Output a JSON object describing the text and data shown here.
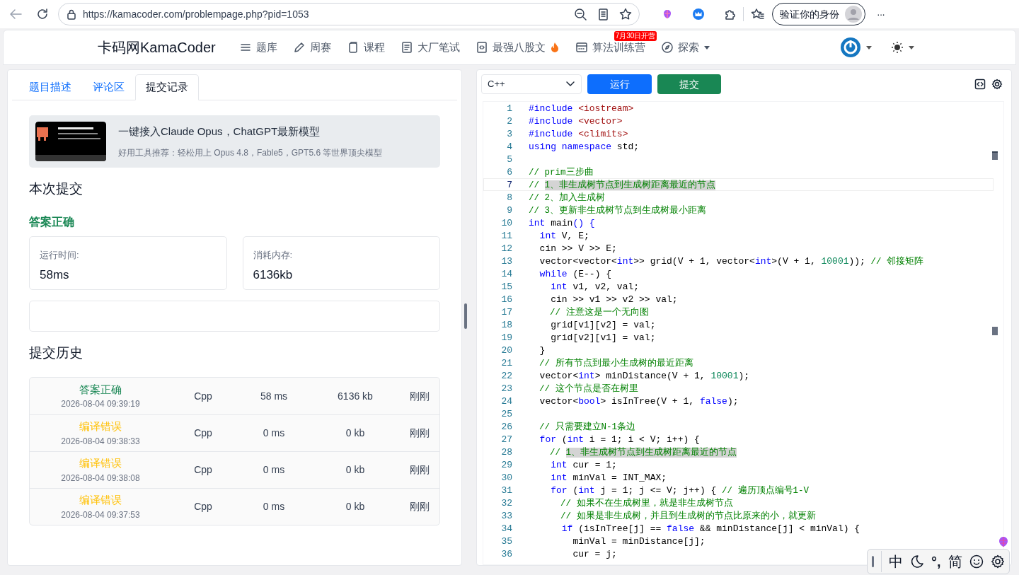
{
  "browser": {
    "url": "https://kamacoder.com/problempage.php?pid=1053",
    "profile_button": "验证你的身份",
    "more": "···"
  },
  "navbar": {
    "brand": "卡码网KamaCoder",
    "items": [
      {
        "label": "题库",
        "kind": "list"
      },
      {
        "label": "周赛",
        "kind": "pencil"
      },
      {
        "label": "课程",
        "kind": "pages"
      },
      {
        "label": "大厂笔试",
        "kind": "doc"
      },
      {
        "label": "最强八股文",
        "kind": "code",
        "flame": true
      },
      {
        "label": "算法训练营",
        "kind": "calendar",
        "badge": "7月30日开营"
      },
      {
        "label": "探索",
        "kind": "compass",
        "dropdown": true
      }
    ]
  },
  "left_panel": {
    "tabs": [
      {
        "label": "题目描述",
        "selected": false
      },
      {
        "label": "评论区",
        "selected": false
      },
      {
        "label": "提交记录",
        "selected": true
      }
    ],
    "banner": {
      "title": "一键接入Claude Opus，ChatGPT最新模型",
      "subtitle": "好用工具推荐：轻松用上 Opus 4.8，Fable5，GPT5.6 等世界顶尖模型"
    },
    "current_heading": "本次提交",
    "result": "答案正确",
    "stats": [
      {
        "label": "运行时间:",
        "value": "58ms"
      },
      {
        "label": "消耗内存:",
        "value": "6136kb"
      }
    ],
    "history_heading": "提交历史",
    "history": [
      {
        "status": "答案正确",
        "kind": "accepted",
        "time": "2026-08-04 09:39:19",
        "language": "Cpp",
        "runtime": "58 ms",
        "memory": "6136 kb",
        "ago": "刚刚"
      },
      {
        "status": "编译错误",
        "kind": "compile_error",
        "time": "2026-08-04 09:38:33",
        "language": "Cpp",
        "runtime": "0 ms",
        "memory": "0 kb",
        "ago": "刚刚"
      },
      {
        "status": "编译错误",
        "kind": "compile_error",
        "time": "2026-08-04 09:38:08",
        "language": "Cpp",
        "runtime": "0 ms",
        "memory": "0 kb",
        "ago": "刚刚"
      },
      {
        "status": "编译错误",
        "kind": "compile_error",
        "time": "2026-08-04 09:37:53",
        "language": "Cpp",
        "runtime": "0 ms",
        "memory": "0 kb",
        "ago": "刚刚"
      }
    ]
  },
  "editor": {
    "language": "C++",
    "run_button": "运行",
    "submit_button": "提交",
    "lines": [
      {
        "number": "1",
        "current": false,
        "tokens": [
          {
            "kind": "keyword",
            "text": "#include "
          },
          {
            "kind": "string",
            "text": "<iostream>"
          }
        ]
      },
      {
        "number": "2",
        "current": false,
        "tokens": [
          {
            "kind": "keyword",
            "text": "#include "
          },
          {
            "kind": "string",
            "text": "<vector>"
          }
        ]
      },
      {
        "number": "3",
        "current": false,
        "tokens": [
          {
            "kind": "keyword",
            "text": "#include "
          },
          {
            "kind": "string",
            "text": "<climits>"
          }
        ]
      },
      {
        "number": "4",
        "current": false,
        "tokens": [
          {
            "kind": "keyword",
            "text": "using namespace "
          },
          {
            "kind": "plain",
            "text": "std;"
          }
        ]
      },
      {
        "number": "5",
        "current": false
      },
      {
        "number": "6",
        "current": false,
        "tokens": [
          {
            "kind": "comment",
            "text": "// prim三步曲"
          }
        ]
      },
      {
        "number": "7",
        "current": true,
        "tokens": [
          {
            "kind": "comment",
            "text": "// "
          },
          {
            "kind": "selected_comment",
            "text": "1、非生成树节点到生成树距离最近的节点"
          }
        ]
      },
      {
        "number": "8",
        "current": false,
        "tokens": [
          {
            "kind": "comment",
            "text": "// 2、加入生成树"
          }
        ]
      },
      {
        "number": "9",
        "current": false,
        "tokens": [
          {
            "kind": "comment",
            "text": "// 3、更新非生成树节点到生成树最小距离"
          }
        ]
      },
      {
        "number": "10",
        "current": false,
        "tokens": [
          {
            "kind": "keyword",
            "text": "int "
          },
          {
            "kind": "plain",
            "text": "main"
          },
          {
            "kind": "keyword",
            "text": "() {"
          }
        ]
      },
      {
        "number": "11",
        "current": false,
        "tokens": [
          {
            "kind": "keyword",
            "text": "  int "
          },
          {
            "kind": "plain",
            "text": "V, E;"
          }
        ]
      },
      {
        "number": "12",
        "current": false,
        "tokens": [
          {
            "kind": "plain",
            "text": "  cin >> V >> E;"
          }
        ]
      },
      {
        "number": "13",
        "current": false,
        "tokens": [
          {
            "kind": "plain",
            "text": "  vector<vector<"
          },
          {
            "kind": "keyword",
            "text": "int"
          },
          {
            "kind": "plain",
            "text": ">> grid(V + 1, vector<"
          },
          {
            "kind": "keyword",
            "text": "int"
          },
          {
            "kind": "plain",
            "text": ">(V + 1, "
          },
          {
            "kind": "number",
            "text": "10001"
          },
          {
            "kind": "plain",
            "text": "));"
          },
          {
            "kind": "comment",
            "text": " // 邻接矩阵"
          }
        ]
      },
      {
        "number": "14",
        "current": false,
        "tokens": [
          {
            "kind": "keyword",
            "text": "  while "
          },
          {
            "kind": "plain",
            "text": "(E--) {"
          }
        ]
      },
      {
        "number": "15",
        "current": false,
        "tokens": [
          {
            "kind": "keyword",
            "text": "    int "
          },
          {
            "kind": "plain",
            "text": "v1, v2, val;"
          }
        ]
      },
      {
        "number": "16",
        "current": false,
        "tokens": [
          {
            "kind": "plain",
            "text": "    cin >> v1 >> v2 >> val;"
          }
        ]
      },
      {
        "number": "17",
        "current": false,
        "tokens": [
          {
            "kind": "comment",
            "text": "    // 注意这是一个无向图"
          }
        ]
      },
      {
        "number": "18",
        "current": false,
        "tokens": [
          {
            "kind": "plain",
            "text": "    grid[v1][v2] = val;"
          }
        ]
      },
      {
        "number": "19",
        "current": false,
        "tokens": [
          {
            "kind": "plain",
            "text": "    grid[v2][v1] = val;"
          }
        ]
      },
      {
        "number": "20",
        "current": false,
        "tokens": [
          {
            "kind": "plain",
            "text": "  }"
          }
        ]
      },
      {
        "number": "21",
        "current": false,
        "tokens": [
          {
            "kind": "comment",
            "text": "  // 所有节点到最小生成树的最近距离"
          }
        ]
      },
      {
        "number": "22",
        "current": false,
        "tokens": [
          {
            "kind": "plain",
            "text": "  vector<"
          },
          {
            "kind": "keyword",
            "text": "int"
          },
          {
            "kind": "plain",
            "text": "> minDistance(V + 1, "
          },
          {
            "kind": "number",
            "text": "10001"
          },
          {
            "kind": "plain",
            "text": ");"
          }
        ]
      },
      {
        "number": "23",
        "current": false,
        "tokens": [
          {
            "kind": "comment",
            "text": "  // 这个节点是否在树里"
          }
        ]
      },
      {
        "number": "24",
        "current": false,
        "tokens": [
          {
            "kind": "plain",
            "text": "  vector<"
          },
          {
            "kind": "keyword",
            "text": "bool"
          },
          {
            "kind": "plain",
            "text": "> isInTree(V + 1, "
          },
          {
            "kind": "keyword",
            "text": "false"
          },
          {
            "kind": "plain",
            "text": ");"
          }
        ]
      },
      {
        "number": "25",
        "current": false
      },
      {
        "number": "26",
        "current": false,
        "tokens": [
          {
            "kind": "comment",
            "text": "  // 只需要建立N-1条边"
          }
        ]
      },
      {
        "number": "27",
        "current": false,
        "tokens": [
          {
            "kind": "keyword",
            "text": "  for "
          },
          {
            "kind": "plain",
            "text": "("
          },
          {
            "kind": "keyword",
            "text": "int "
          },
          {
            "kind": "plain",
            "text": "i = 1; i < V; i++) {"
          }
        ]
      },
      {
        "number": "28",
        "current": false,
        "tokens": [
          {
            "kind": "comment",
            "text": "    // "
          },
          {
            "kind": "selected_comment",
            "text": "1、非生成树节点到生成树距离最近的节点"
          }
        ]
      },
      {
        "number": "29",
        "current": false,
        "tokens": [
          {
            "kind": "keyword",
            "text": "    int "
          },
          {
            "kind": "plain",
            "text": "cur = 1;"
          }
        ]
      },
      {
        "number": "30",
        "current": false,
        "tokens": [
          {
            "kind": "keyword",
            "text": "    int "
          },
          {
            "kind": "plain",
            "text": "minVal = INT_MAX;"
          }
        ]
      },
      {
        "number": "31",
        "current": false,
        "tokens": [
          {
            "kind": "keyword",
            "text": "    for "
          },
          {
            "kind": "plain",
            "text": "("
          },
          {
            "kind": "keyword",
            "text": "int "
          },
          {
            "kind": "plain",
            "text": "j = 1; j <= V; j++) { "
          },
          {
            "kind": "comment",
            "text": "// 遍历顶点编号1-V"
          }
        ]
      },
      {
        "number": "32",
        "current": false,
        "tokens": [
          {
            "kind": "comment",
            "text": "      // 如果不在生成树里，就是非生成树节点"
          }
        ]
      },
      {
        "number": "33",
        "current": false,
        "tokens": [
          {
            "kind": "comment",
            "text": "      // 如果是非生成树，并且到生成树的节点比原来的小，就更新"
          }
        ]
      },
      {
        "number": "34",
        "current": false,
        "tokens": [
          {
            "kind": "keyword",
            "text": "      if "
          },
          {
            "kind": "plain",
            "text": "(isInTree[j] == "
          },
          {
            "kind": "keyword",
            "text": "false "
          },
          {
            "kind": "plain",
            "text": "&& minDistance[j] < minVal) {"
          }
        ]
      },
      {
        "number": "35",
        "current": false,
        "tokens": [
          {
            "kind": "plain",
            "text": "        minVal = minDistance[j];"
          }
        ]
      },
      {
        "number": "36",
        "current": false,
        "tokens": [
          {
            "kind": "plain",
            "text": "        cur = j;"
          }
        ]
      }
    ]
  },
  "ime_toolbar": {
    "keys": [
      "中",
      "°,",
      "简"
    ]
  }
}
